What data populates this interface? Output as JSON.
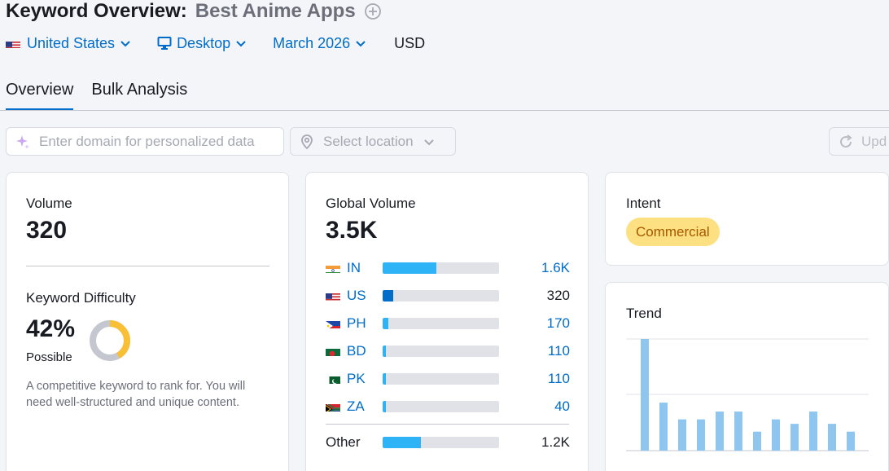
{
  "header": {
    "title": "Keyword Overview:",
    "keyword": "Best Anime Apps"
  },
  "filters": {
    "country": "United States",
    "device": "Desktop",
    "date": "March 2026",
    "currency": "USD"
  },
  "tabs": [
    {
      "label": "Overview",
      "active": true
    },
    {
      "label": "Bulk Analysis",
      "active": false
    }
  ],
  "toolbar": {
    "domain_placeholder": "Enter domain for personalized data",
    "location_placeholder": "Select location",
    "update_label": "Upd"
  },
  "volume_card": {
    "label": "Volume",
    "value": "320",
    "kd_label": "Keyword Difficulty",
    "kd_value": "42%",
    "kd_percent": 42,
    "kd_level": "Possible",
    "kd_description": "A competitive keyword to rank for. You will need well-structured and unique content."
  },
  "global_volume_card": {
    "label": "Global Volume",
    "value": "3.5K",
    "rows": [
      {
        "code": "IN",
        "value": "1.6K",
        "share": 0.46,
        "link": true
      },
      {
        "code": "US",
        "value": "320",
        "share": 0.091,
        "link": false
      },
      {
        "code": "PH",
        "value": "170",
        "share": 0.049,
        "link": true
      },
      {
        "code": "BD",
        "value": "110",
        "share": 0.031,
        "link": true
      },
      {
        "code": "PK",
        "value": "110",
        "share": 0.031,
        "link": true
      },
      {
        "code": "ZA",
        "value": "40",
        "share": 0.02,
        "link": true
      }
    ],
    "other": {
      "label": "Other",
      "value": "1.2K",
      "share": 0.33
    }
  },
  "intent_card": {
    "label": "Intent",
    "badge": "Commercial"
  },
  "trend_card": {
    "label": "Trend",
    "values": [
      1.0,
      0.43,
      0.28,
      0.28,
      0.35,
      0.35,
      0.17,
      0.28,
      0.24,
      0.35,
      0.24,
      0.17
    ]
  },
  "colors": {
    "accent": "#006dca",
    "bar_light": "#2fb3f7",
    "bar_dark": "#006dca",
    "kd_fill": "#f9c036",
    "kd_track": "#c4c7cf",
    "trend_bar": "#8fc6f0",
    "intent_badge_bg": "#fce081",
    "intent_badge_fg": "#a75800"
  }
}
